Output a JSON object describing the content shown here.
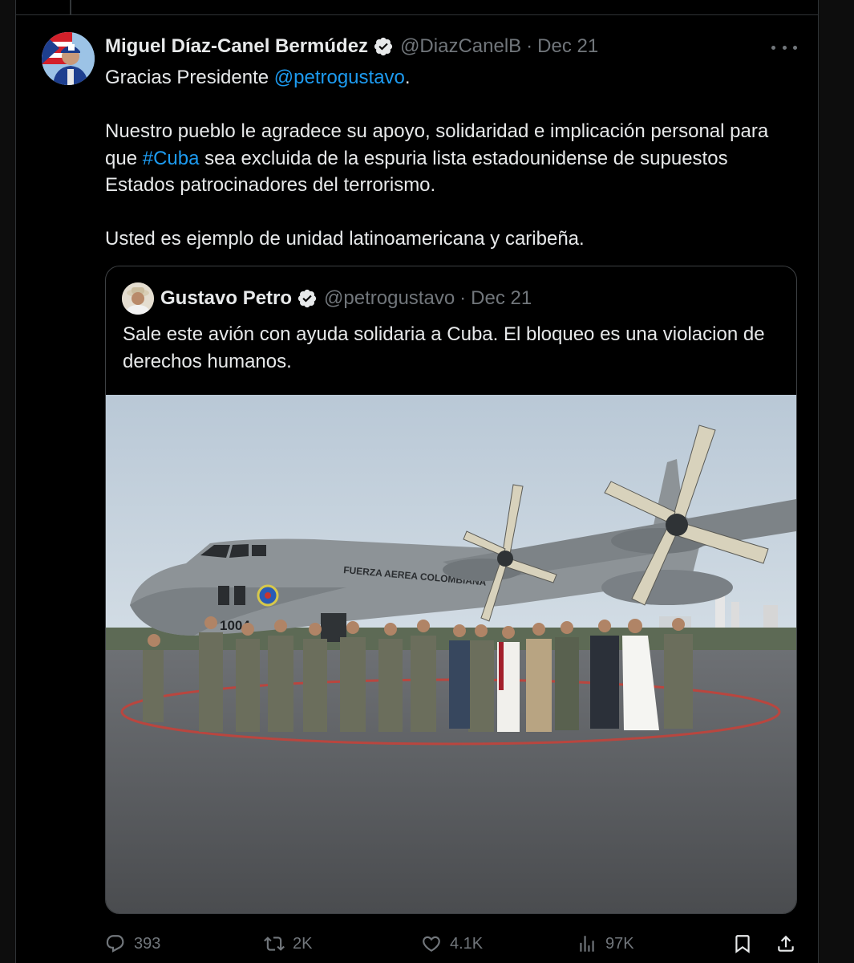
{
  "tweet": {
    "display_name": "Miguel Díaz-Canel Bermúdez",
    "handle": "@DiazCanelB",
    "separator": "·",
    "time": "Dec 21",
    "line1_prefix": "Gracias Presidente ",
    "line1_mention": "@petrogustavo",
    "line1_suffix": ".",
    "para2_before": "Nuestro pueblo le agradece su apoyo, solidaridad e implicación personal para que ",
    "para2_hashtag": "#Cuba",
    "para2_after": " sea excluida de la espuria lista estadounidense de supuestos Estados patrocinadores del terrorismo.",
    "para3": "Usted es ejemplo de unidad latinoamericana y caribeña."
  },
  "quote": {
    "display_name": "Gustavo Petro",
    "handle": "@petrogustavo",
    "separator": "·",
    "time": "Dec 21",
    "text": "Sale este avión con ayuda solidaria a Cuba. El bloqueo es una violacion de derechos humanos.",
    "image_text": {
      "fuselage": "FUERZA AEREA COLOMBIANA",
      "tail_number": "1004"
    }
  },
  "actions": {
    "replies": "393",
    "reposts": "2K",
    "likes": "4.1K",
    "views": "97K"
  },
  "icons": {
    "verified": "verified-badge-icon",
    "more": "more-options-icon",
    "reply": "reply-icon",
    "repost": "repost-icon",
    "like": "heart-icon",
    "views": "views-chart-icon",
    "bookmark": "bookmark-icon",
    "share": "share-icon"
  },
  "colors": {
    "background": "#000000",
    "text": "#e7e9ea",
    "muted": "#71767b",
    "link": "#1d9bf0",
    "border": "#2f3336"
  }
}
